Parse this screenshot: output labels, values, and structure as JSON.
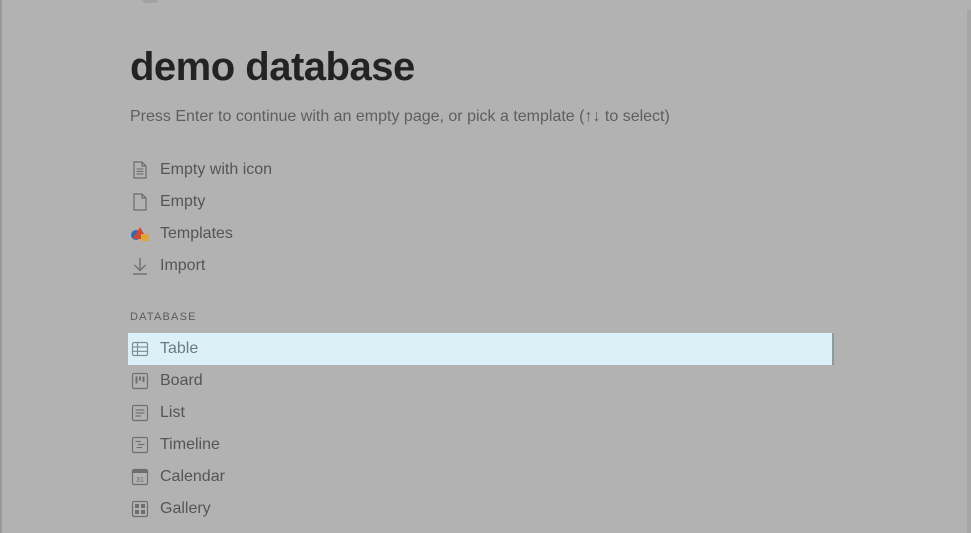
{
  "page": {
    "title": "demo database",
    "hint": "Press Enter to continue with an empty page, or pick a template (↑↓ to select)"
  },
  "options": [
    {
      "label": "Empty with icon",
      "icon": "page-with-lines-icon"
    },
    {
      "label": "Empty",
      "icon": "blank-page-icon"
    },
    {
      "label": "Templates",
      "icon": "templates-shapes-icon"
    },
    {
      "label": "Import",
      "icon": "import-arrow-icon"
    }
  ],
  "database": {
    "section_label": "DATABASE",
    "selected_index": 0,
    "items": [
      {
        "label": "Table",
        "icon": "table-icon"
      },
      {
        "label": "Board",
        "icon": "board-icon"
      },
      {
        "label": "List",
        "icon": "list-icon"
      },
      {
        "label": "Timeline",
        "icon": "timeline-icon"
      },
      {
        "label": "Calendar",
        "icon": "calendar-icon",
        "icon_text": "31"
      },
      {
        "label": "Gallery",
        "icon": "gallery-icon"
      }
    ]
  },
  "colors": {
    "backdrop": "#b2b2b2",
    "selected_row": "#dcf0f8",
    "title_text": "#232323"
  }
}
